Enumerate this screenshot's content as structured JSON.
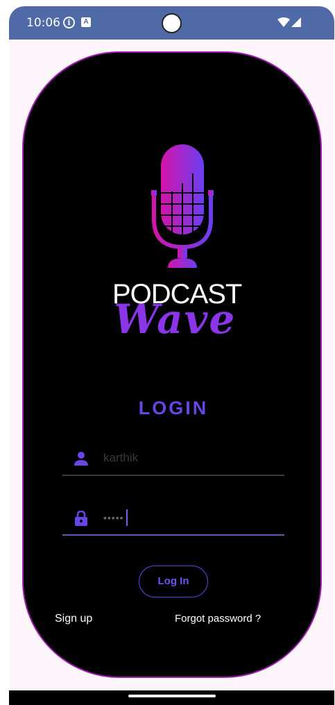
{
  "status_bar": {
    "time": "10:06",
    "info_icon": "info-icon",
    "a_icon": "A",
    "wifi_icon": "wifi-icon",
    "signal_icon": "signal-icon"
  },
  "logo": {
    "line1": "PODCAST",
    "line2": "Wave",
    "icon": "microphone-icon"
  },
  "login": {
    "title": "LOGIN",
    "username_value": "karthik",
    "username_icon": "person-icon",
    "password_value": "•••••",
    "password_icon": "lock-icon",
    "button_label": "Log In",
    "signup_label": "Sign up",
    "forgot_label": "Forgot password ?"
  },
  "colors": {
    "status_bar": "#4f6aa6",
    "card_border": "#a01fb0",
    "accent": "#6a45e6",
    "logo_gradient_start": "#d414a8",
    "logo_gradient_end": "#6a3ef0"
  }
}
